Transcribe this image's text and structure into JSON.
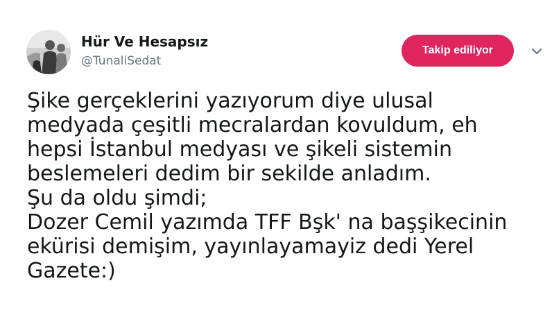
{
  "author": {
    "display_name": "Hür Ve Hesapsız",
    "handle": "@TunaliSedat",
    "avatar": "profile-photo"
  },
  "follow_button": {
    "label": "Takip ediliyor",
    "color": "#e0245e"
  },
  "menu": {
    "icon": "chevron-down-icon"
  },
  "tweet": {
    "text": "Şike gerçeklerini yazıyorum diye ulusal\nmedyada çeşitli mecralardan kovuldum, eh\nhepsi İstanbul medyası ve şikeli sistemin\nbeslemeleri dedim bir sekilde anladım.\nŞu da oldu şimdi;\nDozer Cemil yazımda TFF Bşk' na başşikecinin\nekürisi demişim, yayınlayamayiz dedi Yerel\nGazete:)"
  }
}
